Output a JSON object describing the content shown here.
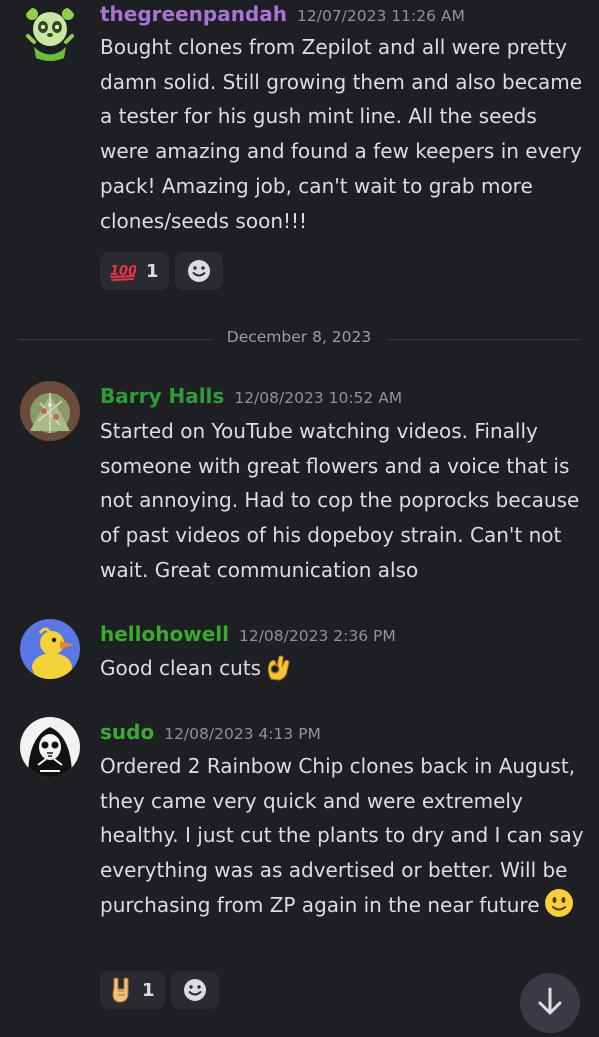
{
  "colors": {
    "background": "#1e1f23",
    "timestamp": "#8f929a",
    "reaction_bg": "#2a2b31",
    "divider_text": "#9a9ca3"
  },
  "messages": [
    {
      "username": "thegreenpandah",
      "name_color": "#a774d6",
      "timestamp": "12/07/2023 11:26 AM",
      "avatar_icon": "panda-avatar",
      "text": "Bought clones from Zepilot and all were pretty damn solid. Still growing them and also became a tester for his gush mint line. All the seeds were amazing and found a few keepers in every pack! Amazing job, can't wait to grab more clones/seeds soon!!!",
      "reaction": {
        "emoji_icon": "hundred-points-icon",
        "count": "1"
      }
    },
    {
      "username": "Barry Halls",
      "name_color": "#2f9c3a",
      "timestamp": "12/08/2023 10:52 AM",
      "avatar_icon": "cannabis-bud-avatar",
      "text": "Started on YouTube watching videos. Finally someone with great flowers and a voice that is not annoying. Had to cop the poprocks because of past videos of his dopeboy strain. Can't not wait. Great communication also"
    },
    {
      "username": "hellohowell",
      "name_color": "#3bab2f",
      "timestamp": "12/08/2023 2:36 PM",
      "avatar_icon": "duck-avatar",
      "text": "Good clean cuts",
      "trailing_emoji": "ok-hand-icon"
    },
    {
      "username": "sudo",
      "name_color": "#3bab2f",
      "timestamp": "12/08/2023 4:13 PM",
      "avatar_icon": "skeleton-avatar",
      "text": "Ordered 2 Rainbow Chip clones back in August, they came very quick and were extremely healthy. I just cut the plants to dry and I can say everything was as advertised or better. Will be purchasing from ZP again in the near future",
      "trailing_emoji": "slightly-smiling-face-icon",
      "reaction": {
        "emoji_icon": "rock-on-hand-icon",
        "count": "1"
      }
    }
  ],
  "date_divider": "December 8, 2023",
  "scroll_button_icon": "arrow-down-icon"
}
